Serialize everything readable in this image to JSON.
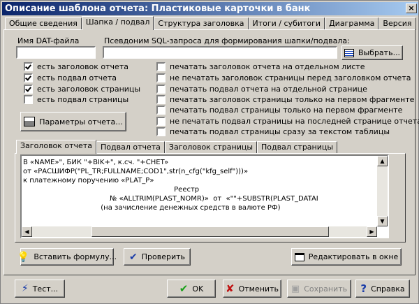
{
  "window": {
    "title": "Описание шаблона отчета: Пластиковые карточки в банк",
    "close": "×"
  },
  "main_tabs": [
    "Общие сведения",
    "Шапка / подвал",
    "Структура заголовка",
    "Итоги / субитоги",
    "Диаграмма",
    "Версия"
  ],
  "fields": {
    "dat_label": "Имя DAT-файла",
    "dat_value": "",
    "alias_label": "Псевдоним SQL-запроса для формирования шапки/подвала:",
    "alias_value": "",
    "select_button": "Выбрать..."
  },
  "left_checks": [
    {
      "label": "есть заголовок отчета",
      "checked": true
    },
    {
      "label": "есть подвал отчета",
      "checked": true
    },
    {
      "label": "есть заголовок страницы",
      "checked": true
    },
    {
      "label": "есть подвал страницы",
      "checked": false
    }
  ],
  "right_checks": [
    {
      "label": "печатать заголовок отчета на отдельном листе",
      "checked": false
    },
    {
      "label": "не печатать заголовок страницы перед заголовком отчета",
      "checked": false
    },
    {
      "label": "печатать подвал отчета на отдельной странице",
      "checked": false
    },
    {
      "label": "печатать заголовок страницы только на первом фрагменте",
      "checked": false
    },
    {
      "label": "печатать подвал страницы только на первом фрагменте",
      "checked": false
    },
    {
      "label": "не печатать подвал страницы на последней странице отчета",
      "checked": false
    },
    {
      "label": "печатать подвал страницы сразу за текстом таблицы",
      "checked": false
    }
  ],
  "params_button": "Параметры отчета...",
  "sub_tabs": [
    "Заголовок отчета",
    "Подвал отчета",
    "Заголовок страницы",
    "Подвал страницы"
  ],
  "editor_lines": [
    "В «NAME»\", БИК \"+BIK+\", к.сч. \"+CHET»",
    "от «РАСШИФР(\"PL_TR;FULLNAME;COD1\",str(n_cfg(\"kfg_self\")))»",
    "к платежному поручению «PLAT_P»",
    "                                                                    Реестр",
    "                                       № «ALLTRIM(PLAST_NOMR)»  от  «\"\"+SUBSTR(PLAST_DATAI",
    "                                   (на зачисление денежных средств в валюте РФ)"
  ],
  "buttons": {
    "insert_formula": "Вставить формулу...",
    "check": "Проверить",
    "edit_window": "Редактировать в окне",
    "test": "Тест...",
    "ok": "OK",
    "cancel": "Отменить",
    "save": "Сохранить",
    "help": "Справка"
  }
}
